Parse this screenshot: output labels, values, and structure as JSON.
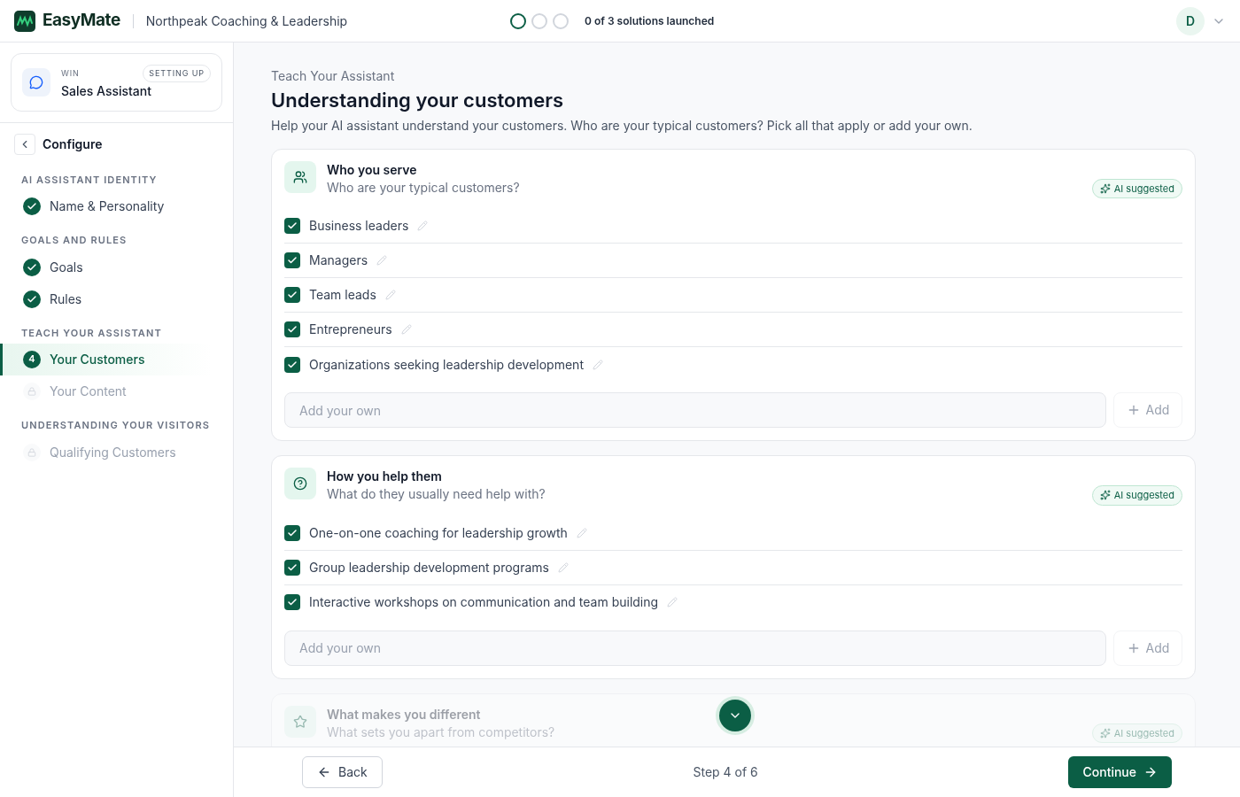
{
  "header": {
    "brand": "EasyMate",
    "org": "Northpeak Coaching & Leadership",
    "progress": [
      {
        "current": true
      },
      {
        "current": false
      },
      {
        "current": false
      }
    ],
    "progress_text": "0 of 3 solutions launched",
    "avatar": "D"
  },
  "assistant_card": {
    "eyebrow": "WIN",
    "name": "Sales Assistant",
    "badge": "SETTING UP"
  },
  "sidebar": {
    "title": "Configure",
    "groups": [
      {
        "heading": "AI ASSISTANT IDENTITY",
        "items": [
          {
            "label": "Name & Personality",
            "kind": "done",
            "selected": false
          }
        ]
      },
      {
        "heading": "GOALS AND RULES",
        "items": [
          {
            "label": "Goals",
            "kind": "done",
            "selected": false
          },
          {
            "label": "Rules",
            "kind": "done",
            "selected": false
          }
        ]
      },
      {
        "heading": "TEACH YOUR ASSISTANT",
        "items": [
          {
            "label": "Your Customers",
            "kind": "current",
            "selected": true,
            "number": "4"
          },
          {
            "label": "Your Content",
            "kind": "locked",
            "selected": false
          }
        ]
      },
      {
        "heading": "UNDERSTANDING YOUR VISITORS",
        "items": [
          {
            "label": "Qualifying Customers",
            "kind": "locked",
            "selected": false
          }
        ]
      }
    ]
  },
  "page": {
    "eyebrow": "Teach Your Assistant",
    "title": "Understanding your customers",
    "description": "Help your AI assistant understand your customers. Who are your typical customers? Pick all that apply or add your own."
  },
  "sections": [
    {
      "title": "Who you serve",
      "subtitle": "Who are your typical customers?",
      "badge": "AI suggested",
      "faded": false,
      "placeholder": "Add your own",
      "add": "Add",
      "options": [
        {
          "label": "Business leaders",
          "checked": true
        },
        {
          "label": "Managers",
          "checked": true
        },
        {
          "label": "Team leads",
          "checked": true
        },
        {
          "label": "Entrepreneurs",
          "checked": true
        },
        {
          "label": "Organizations seeking leadership development",
          "checked": true
        }
      ]
    },
    {
      "title": "How you help them",
      "subtitle": "What do they usually need help with?",
      "badge": "AI suggested",
      "faded": false,
      "placeholder": "Add your own",
      "add": "Add",
      "options": [
        {
          "label": "One-on-one coaching for leadership growth",
          "checked": true
        },
        {
          "label": "Group leadership development programs",
          "checked": true
        },
        {
          "label": "Interactive workshops on communication and team building",
          "checked": true
        }
      ]
    },
    {
      "title": "What makes you different",
      "subtitle": "What sets you apart from competitors?",
      "badge": "AI suggested",
      "faded": true
    }
  ],
  "footer": {
    "back": "Back",
    "step": "Step 4 of 6",
    "continue": "Continue"
  }
}
